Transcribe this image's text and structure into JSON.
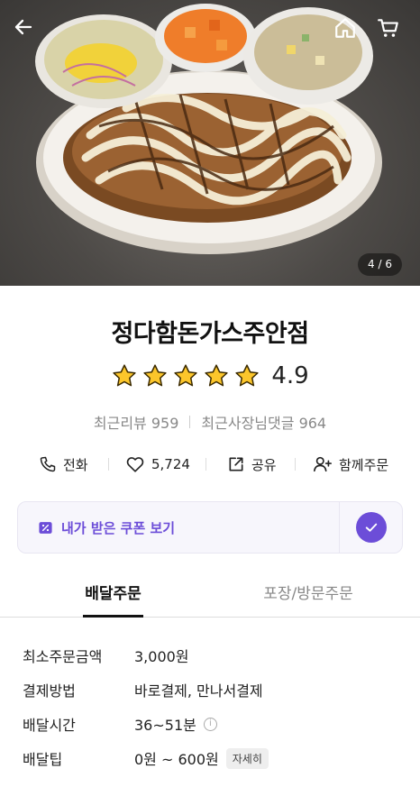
{
  "hero": {
    "counter": "4 / 6",
    "icons": {
      "back": "back-arrow-icon",
      "home": "home-icon",
      "cart": "cart-icon"
    }
  },
  "store": {
    "name": "정다함돈가스주안점",
    "rating": "4.9",
    "rating_stars": 5,
    "recent_reviews_label": "최근리뷰",
    "recent_reviews_count": "959",
    "owner_replies_label": "최근사장님댓글",
    "owner_replies_count": "964"
  },
  "actions": [
    {
      "label": "전화",
      "icon": "phone-icon"
    },
    {
      "label": "5,724",
      "icon": "heart-icon"
    },
    {
      "label": "공유",
      "icon": "share-icon"
    },
    {
      "label": "함께주문",
      "icon": "add-person-icon"
    }
  ],
  "coupon": {
    "label": "내가 받은 쿠폰 보기",
    "icon": "coupon-icon",
    "accent": "#6c4dd8"
  },
  "tabs": [
    {
      "label": "배달주문",
      "active": true
    },
    {
      "label": "포장/방문주문",
      "active": false
    }
  ],
  "delivery_info": {
    "min_order_label": "최소주문금액",
    "min_order_value": "3,000원",
    "payment_label": "결제방법",
    "payment_value": "바로결제, 만나서결제",
    "time_label": "배달시간",
    "time_value": "36~51분",
    "tip_label": "배달팁",
    "tip_value": "0원 ~ 600원",
    "tip_detail_button": "자세히"
  }
}
